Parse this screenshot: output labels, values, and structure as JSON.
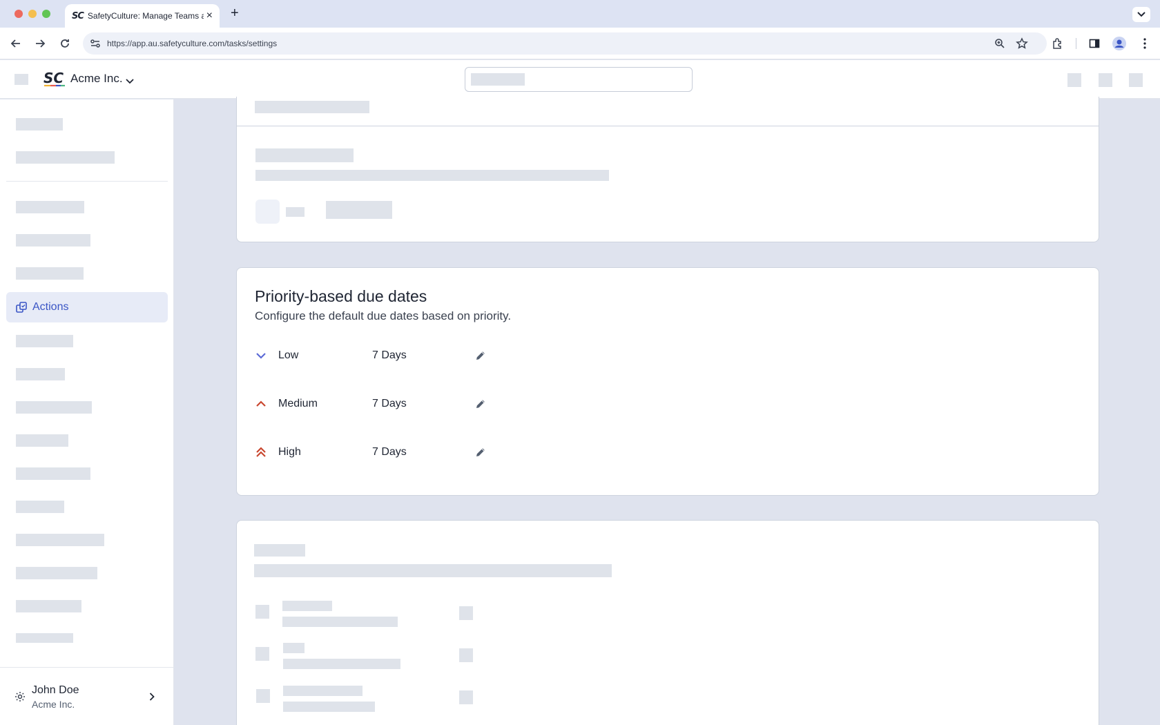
{
  "browser": {
    "tab_title": "SafetyCulture: Manage Teams and...",
    "tab_favicon": "SC",
    "url": "https://app.au.safetyculture.com/tasks/settings"
  },
  "header": {
    "org_name": "Acme Inc.",
    "logo_icon": "safetyculture-logo"
  },
  "sidebar": {
    "active_item": {
      "label": "Actions",
      "icon": "actions-icon"
    },
    "user": {
      "name": "John Doe",
      "org": "Acme Inc."
    }
  },
  "priority": {
    "title": "Priority-based due dates",
    "subtitle": "Configure the default due dates based on priority.",
    "rows": [
      {
        "label": "Low",
        "days": "7 Days",
        "icon": "chevron-down-icon",
        "color": "#5b6ad6"
      },
      {
        "label": "Medium",
        "days": "7 Days",
        "icon": "chevron-up-icon",
        "color": "#c9472f"
      },
      {
        "label": "High",
        "days": "7 Days",
        "icon": "double-chevron-up-icon",
        "color": "#c9472f"
      }
    ]
  },
  "colors": {
    "accent": "#3a55c5",
    "active_bg": "#e7ebf7",
    "skeleton": "#dfe3ea",
    "page_bg": "#dfe3ee"
  }
}
